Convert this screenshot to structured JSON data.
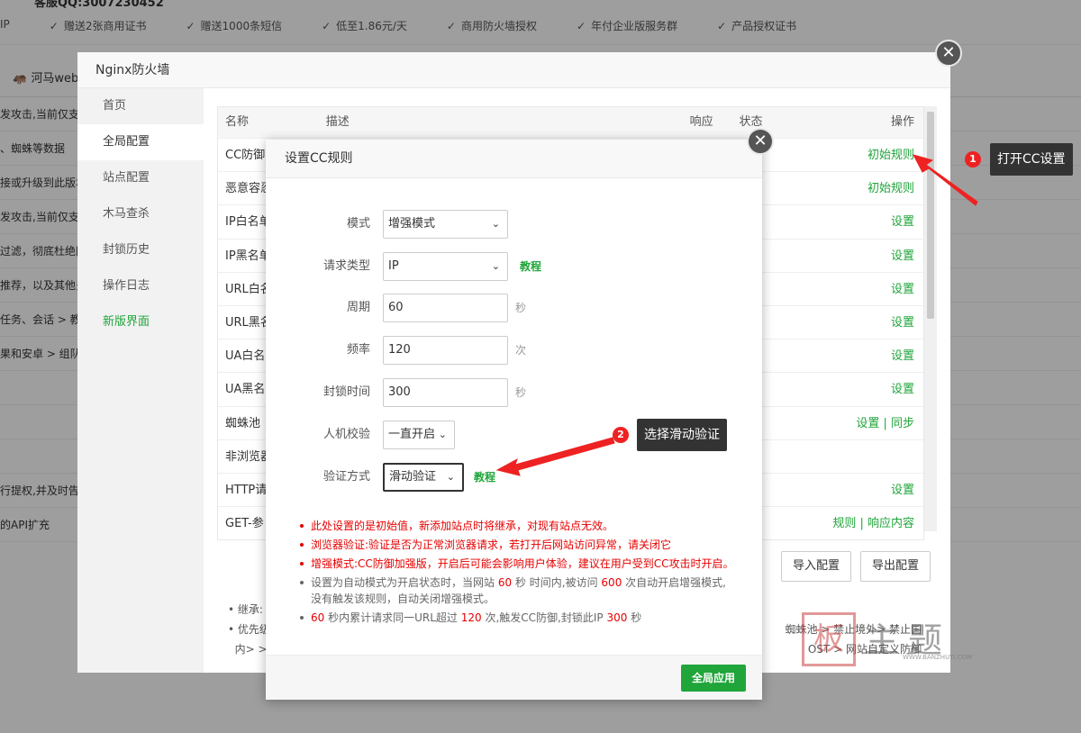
{
  "background": {
    "top_cut_text": "客服QQ:3007230452",
    "features": [
      "IP",
      "赠送2张商用证书",
      "赠送1000条短信",
      "低至1.86元/天",
      "商用防火墙授权",
      "年付企业版服务群",
      "产品授权证书"
    ],
    "site_name": "河马web",
    "rows": [
      "发攻击,当前仅支持",
      "、蜘蛛等数据",
      "接或升级到此版本",
      "发攻击,当前仅支持",
      "过滤，彻底杜绝网",
      "推荐，以及其他多",
      "任务、会话 > 教程",
      "果和安卓 > 组队",
      "",
      "",
      "",
      "行提权,并及时告",
      "的API扩充"
    ]
  },
  "firewall": {
    "title": "Nginx防火墙",
    "sidebar": [
      {
        "label": "首页"
      },
      {
        "label": "全局配置"
      },
      {
        "label": "站点配置"
      },
      {
        "label": "木马查杀"
      },
      {
        "label": "封锁历史"
      },
      {
        "label": "操作日志"
      },
      {
        "label": "新版界面"
      }
    ],
    "table": {
      "headers": {
        "name": "名称",
        "desc": "描述",
        "resp": "响应",
        "status": "状态",
        "op": "操作"
      },
      "rows": [
        {
          "name": "CC防御",
          "op": "初始规则"
        },
        {
          "name": "恶意容忍",
          "op": "初始规则"
        },
        {
          "name": "IP白名单",
          "op": "设置"
        },
        {
          "name": "IP黑名单",
          "op": "设置"
        },
        {
          "name": "URL白名",
          "op": "设置"
        },
        {
          "name": "URL黑名",
          "op": "设置"
        },
        {
          "name": "UA白名",
          "op": "设置"
        },
        {
          "name": "UA黑名",
          "op": "设置"
        },
        {
          "name": "蜘蛛池",
          "op": "设置 | 同步"
        },
        {
          "name": "非浏览器",
          "op": ""
        },
        {
          "name": "HTTP请",
          "op": "设置"
        },
        {
          "name": "GET-参",
          "op": "规则 | 响应内容"
        }
      ]
    },
    "import_label": "导入配置",
    "export_label": "导出配置",
    "notes": [
      "继承: 全",
      "优先级:",
      "内> >",
      "蜘蛛池 > 禁止境外> 禁止国",
      "OST > 网站自定义防御"
    ]
  },
  "cc_dialog": {
    "title": "设置CC规则",
    "form": {
      "mode": {
        "label": "模式",
        "value": "增强模式"
      },
      "request_type": {
        "label": "请求类型",
        "value": "IP",
        "link": "教程"
      },
      "period": {
        "label": "周期",
        "value": "60",
        "unit": "秒"
      },
      "frequency": {
        "label": "频率",
        "value": "120",
        "unit": "次"
      },
      "block_time": {
        "label": "封锁时间",
        "value": "300",
        "unit": "秒"
      },
      "human_check": {
        "label": "人机校验",
        "value": "一直开启"
      },
      "verify_method": {
        "label": "验证方式",
        "value": "滑动验证",
        "link": "教程"
      }
    },
    "notes": {
      "n1": "此处设置的是初始值，新添加站点时将继承，对现有站点无效。",
      "n2": "浏览器验证:验证是否为正常浏览器请求，若打开后网站访问异常，请关闭它",
      "n3": "增强模式:CC防御加强版，开启后可能会影响用户体验，建议在用户受到CC攻击时开启。",
      "n4a": "设置为自动模式为开启状态时，当网站",
      "n4_v1": "60",
      "n4b": "秒 时间内,被访问",
      "n4_v2": "600",
      "n4c": "次自动开启增强模式,",
      "n4d": "没有触发该规则，自动关闭增强模式。",
      "n5_v1": "60",
      "n5a": "秒内累计请求同一URL超过",
      "n5_v2": "120",
      "n5b": "次,触发CC防御,封锁此IP",
      "n5_v3": "300",
      "n5c": "秒"
    },
    "apply_label": "全局应用"
  },
  "annotations": {
    "step1_num": "1",
    "step1_text": "打开CC设置",
    "step2_num": "2",
    "step2_text": "选择滑动验证"
  },
  "watermark": {
    "seal": "板",
    "text": "主题",
    "url": "WWW.BANZHUTI.COM"
  },
  "colors": {
    "accent_green": "#20a53a",
    "note_red": "#e60000",
    "annotation_red": "#e22222"
  }
}
